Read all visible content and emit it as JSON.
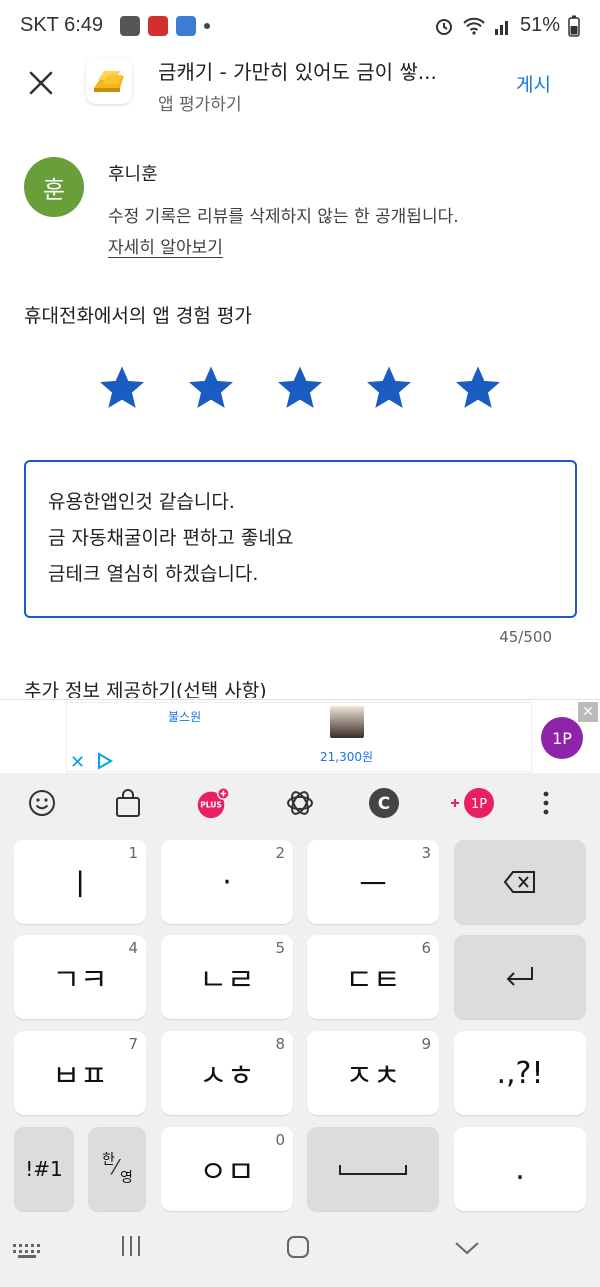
{
  "status_bar": {
    "time": "SKT 6:49",
    "battery": "51%"
  },
  "header": {
    "app_title": "금캐기 - 가만히 있어도 금이 쌓...",
    "subtitle": "앱 평가하기",
    "post_label": "게시"
  },
  "user": {
    "avatar_initial": "훈",
    "name": "후니훈",
    "note": "수정 기록은 리뷰를 삭제하지 않는 한 공개됩니다.",
    "learn_more": "자세히 알아보기"
  },
  "rating": {
    "label": "휴대전화에서의 앱 경험 평가",
    "value": 5,
    "max": 5,
    "star_color": "#1a5cc2"
  },
  "review": {
    "lines": [
      "유용한앱인것 같습니다.",
      "금 자동채굴이라 편하고 좋네요",
      "금테크 열심히 하겠습니다."
    ],
    "char_count": "45/500"
  },
  "extra_info": "추가 정보 제공하기(선택 사항)",
  "ad": {
    "brand": "불스원",
    "price": "21,300원",
    "badge": "1P"
  },
  "keyboard": {
    "toolbar": {
      "plus_label": "PLUS",
      "c_label": "C",
      "points_label": "1P"
    },
    "keys": [
      {
        "label": "ㅣ",
        "num": "1"
      },
      {
        "label": "·",
        "num": "2"
      },
      {
        "label": "ㅡ",
        "num": "3"
      },
      {
        "label": "ㄱㅋ",
        "num": "4"
      },
      {
        "label": "ㄴㄹ",
        "num": "5"
      },
      {
        "label": "ㄷㅌ",
        "num": "6"
      },
      {
        "label": "ㅂㅍ",
        "num": "7"
      },
      {
        "label": "ㅅㅎ",
        "num": "8"
      },
      {
        "label": "ㅈㅊ",
        "num": "9"
      },
      {
        "label": ".,?!",
        "num": ""
      },
      {
        "label": "!#1",
        "num": ""
      },
      {
        "label": "ㅇㅁ",
        "num": "0"
      },
      {
        "label": ".",
        "num": ""
      }
    ],
    "lang_top": "한",
    "lang_bottom": "영"
  }
}
